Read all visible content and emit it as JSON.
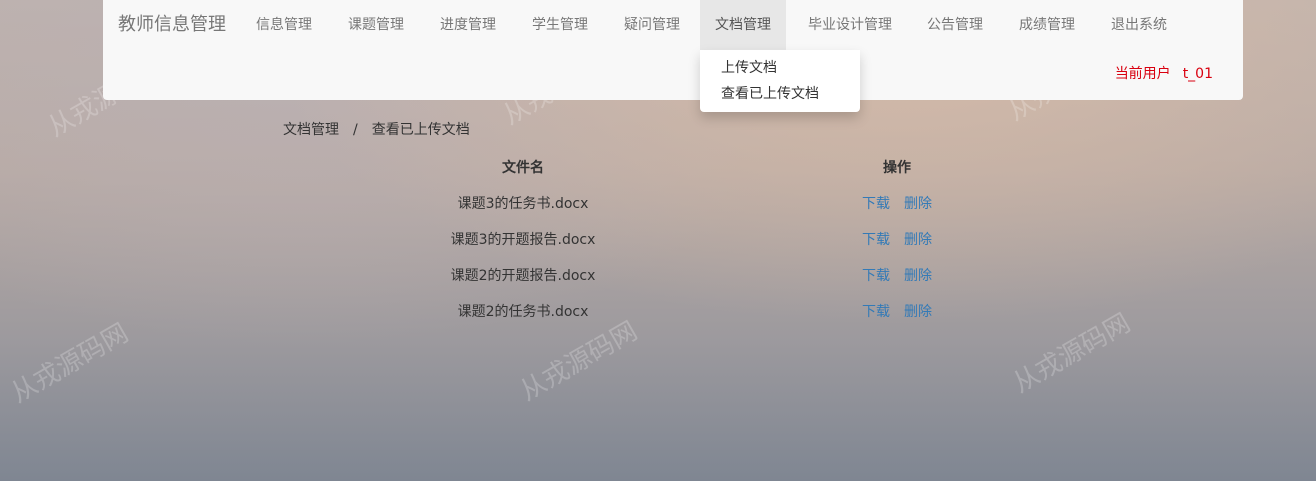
{
  "navbar": {
    "brand": "教师信息管理",
    "items": [
      {
        "label": "信息管理"
      },
      {
        "label": "课题管理"
      },
      {
        "label": "进度管理"
      },
      {
        "label": "学生管理"
      },
      {
        "label": "疑问管理"
      },
      {
        "label": "文档管理",
        "active": true
      },
      {
        "label": "毕业设计管理"
      },
      {
        "label": "公告管理"
      },
      {
        "label": "成绩管理"
      },
      {
        "label": "退出系统"
      }
    ],
    "current_user_label": "当前用户",
    "current_user_name": "t_01"
  },
  "dropdown": {
    "items": [
      {
        "label": "上传文档"
      },
      {
        "label": "查看已上传文档"
      }
    ]
  },
  "breadcrumb": {
    "parent": "文档管理",
    "separator": "/",
    "current": "查看已上传文档"
  },
  "table": {
    "headers": {
      "name": "文件名",
      "ops": "操作"
    },
    "rows": [
      {
        "name": "课题3的任务书.docx",
        "download": "下载",
        "delete": "删除"
      },
      {
        "name": "课题3的开题报告.docx",
        "download": "下载",
        "delete": "删除"
      },
      {
        "name": "课题2的开题报告.docx",
        "download": "下载",
        "delete": "删除"
      },
      {
        "name": "课题2的任务书.docx",
        "download": "下载",
        "delete": "删除"
      }
    ]
  },
  "watermark_text": "从戎源码网",
  "colors": {
    "link": "#337ab7",
    "current_user": "#d9000f",
    "navbar_bg": "#f8f8f8",
    "active_nav_bg": "#e7e7e7"
  }
}
